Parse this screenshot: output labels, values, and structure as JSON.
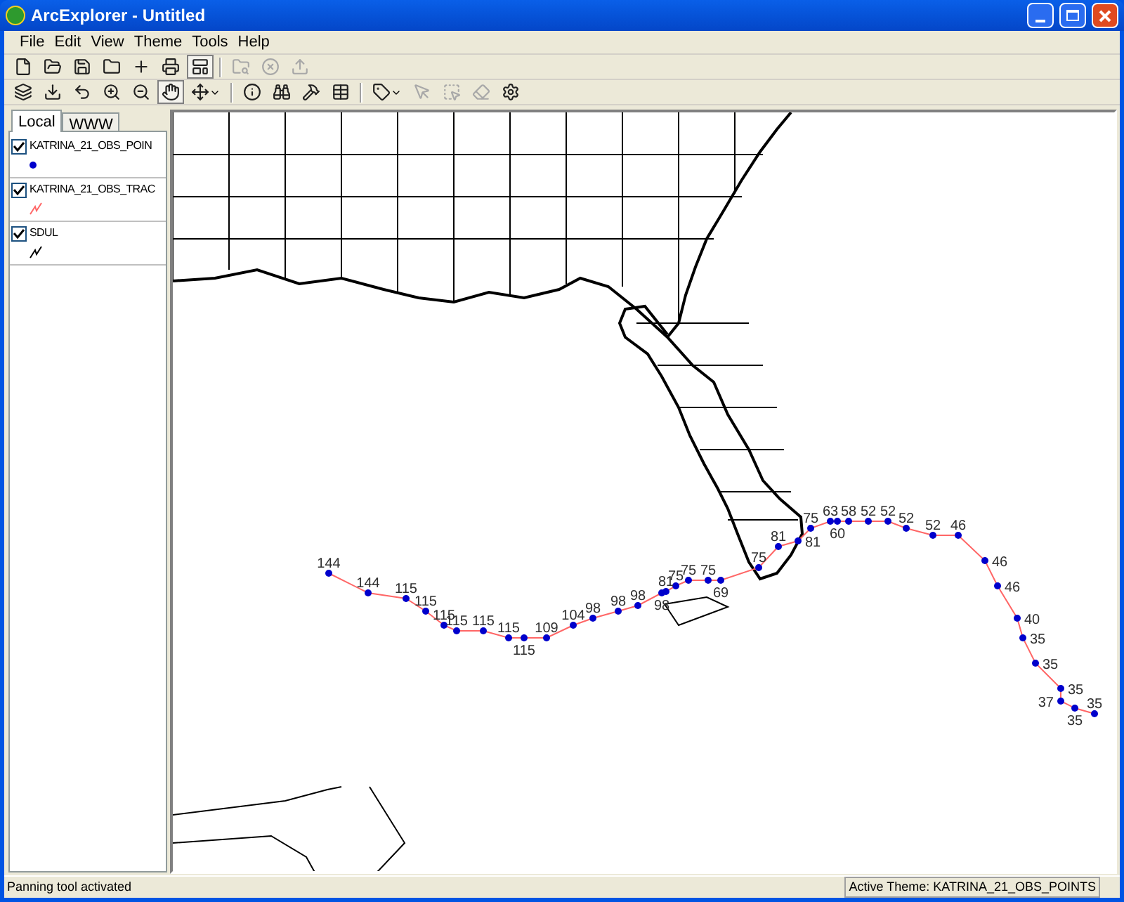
{
  "window": {
    "title": "ArcExplorer - Untitled"
  },
  "menu": [
    "File",
    "Edit",
    "View",
    "Theme",
    "Tools",
    "Help"
  ],
  "toolbars": [
    [
      {
        "kind": "new",
        "disabled": false,
        "pressed": false
      },
      {
        "kind": "open",
        "disabled": false,
        "pressed": false
      },
      {
        "kind": "save",
        "disabled": false,
        "pressed": false
      },
      {
        "kind": "folder",
        "disabled": false,
        "pressed": false
      },
      {
        "kind": "add",
        "disabled": false,
        "pressed": false
      },
      {
        "kind": "print",
        "disabled": false,
        "pressed": false
      },
      {
        "kind": "layout",
        "disabled": false,
        "pressed": true
      },
      {
        "kind": "sep"
      },
      {
        "kind": "catalog",
        "disabled": true,
        "pressed": false
      },
      {
        "kind": "stop",
        "disabled": true,
        "pressed": false
      },
      {
        "kind": "export",
        "disabled": true,
        "pressed": false
      }
    ],
    [
      {
        "kind": "addtheme",
        "disabled": false,
        "pressed": false
      },
      {
        "kind": "savetheme",
        "disabled": false,
        "pressed": false
      },
      {
        "kind": "undo",
        "disabled": false,
        "pressed": false
      },
      {
        "kind": "zoomin",
        "disabled": false,
        "pressed": false
      },
      {
        "kind": "zoomout",
        "disabled": false,
        "pressed": false
      },
      {
        "kind": "pan",
        "disabled": false,
        "pressed": true
      },
      {
        "kind": "move",
        "disabled": false,
        "pressed": false
      },
      {
        "kind": "sep"
      },
      {
        "kind": "info",
        "disabled": false,
        "pressed": false
      },
      {
        "kind": "find",
        "disabled": false,
        "pressed": false
      },
      {
        "kind": "hammer",
        "disabled": false,
        "pressed": false
      },
      {
        "kind": "query",
        "disabled": false,
        "pressed": false
      },
      {
        "kind": "sep"
      },
      {
        "kind": "label",
        "disabled": false,
        "pressed": false
      },
      {
        "kind": "pointer",
        "disabled": true,
        "pressed": false
      },
      {
        "kind": "select",
        "disabled": true,
        "pressed": false
      },
      {
        "kind": "erase",
        "disabled": true,
        "pressed": false
      },
      {
        "kind": "props",
        "disabled": false,
        "pressed": false
      }
    ]
  ],
  "tabs": [
    {
      "label": "Local",
      "selected": true
    },
    {
      "label": "WWW",
      "selected": false
    }
  ],
  "layers": [
    {
      "label": "KATRINA_21_OBS_POIN",
      "checked": true,
      "kind": "point",
      "color": "#0000cc"
    },
    {
      "label": "KATRINA_21_OBS_TRAC",
      "checked": true,
      "kind": "line",
      "color": "#ff6666"
    },
    {
      "label": "SDUL",
      "checked": true,
      "kind": "line",
      "color": "#000000"
    }
  ],
  "track_labels": [
    "144",
    "144",
    "115",
    "115",
    "115",
    "115",
    "115",
    "115",
    "115",
    "109",
    "104",
    "98",
    "98",
    "98",
    "98",
    "81",
    "75",
    "75",
    "75",
    "69",
    "75",
    "81",
    "81",
    "75",
    "63",
    "60",
    "58",
    "52",
    "52",
    "52",
    "52",
    "46",
    "46",
    "46",
    "40",
    "35",
    "35",
    "35",
    "37",
    "35",
    "35"
  ],
  "status": {
    "message": "Panning tool activated",
    "active_theme": "Active Theme: KATRINA_21_OBS_POINTS"
  }
}
